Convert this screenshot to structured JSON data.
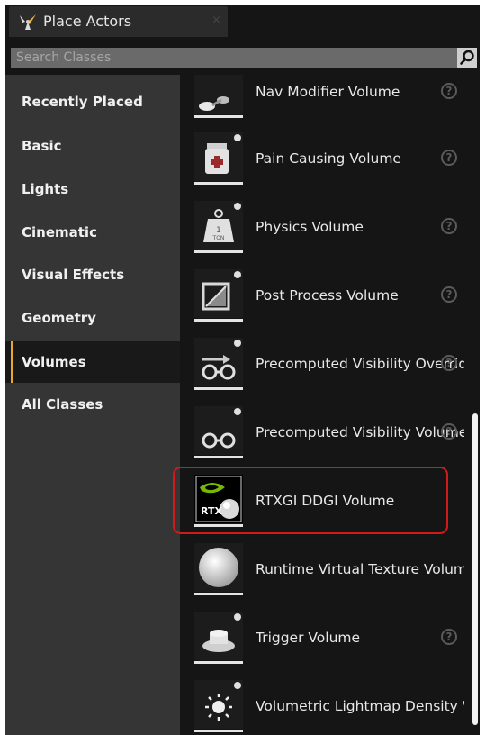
{
  "tab": {
    "title": "Place Actors",
    "close": "×"
  },
  "search": {
    "placeholder": "Search Classes",
    "value": ""
  },
  "nav": {
    "items": [
      {
        "label": "Recently Placed"
      },
      {
        "label": "Basic"
      },
      {
        "label": "Lights"
      },
      {
        "label": "Cinematic"
      },
      {
        "label": "Visual Effects"
      },
      {
        "label": "Geometry"
      },
      {
        "label": "Volumes",
        "active": true
      },
      {
        "label": "All Classes"
      }
    ]
  },
  "list": {
    "items": [
      {
        "label": "Nav Modifier Volume",
        "icon": "nav-modifier-volume-icon",
        "help": "?"
      },
      {
        "label": "Pain Causing Volume",
        "icon": "pain-causing-volume-icon",
        "help": "?"
      },
      {
        "label": "Physics Volume",
        "icon": "physics-volume-icon",
        "help": "?"
      },
      {
        "label": "Post Process Volume",
        "icon": "post-process-volume-icon",
        "help": "?"
      },
      {
        "label": "Precomputed Visibility Override Volume",
        "icon": "precomputed-visibility-override-icon",
        "help": "?"
      },
      {
        "label": "Precomputed Visibility Volume",
        "icon": "precomputed-visibility-volume-icon",
        "help": "?"
      },
      {
        "label": "RTXGI DDGI Volume",
        "icon": "rtxgi-icon",
        "highlighted": true,
        "badge": "RTX"
      },
      {
        "label": "Runtime Virtual Texture Volume",
        "icon": "runtime-virtual-texture-icon"
      },
      {
        "label": "Trigger Volume",
        "icon": "trigger-volume-icon",
        "help": "?"
      },
      {
        "label": "Volumetric Lightmap Density Volume",
        "icon": "volumetric-lightmap-icon"
      }
    ]
  },
  "colors": {
    "accent": "#e6a82e",
    "highlight": "#d31a1a",
    "nav_bg": "#353535",
    "list_bg": "#151515",
    "rtx_green": "#76b900"
  },
  "scrollbar": {
    "position": 0.58,
    "visible_fraction": 0.47
  }
}
